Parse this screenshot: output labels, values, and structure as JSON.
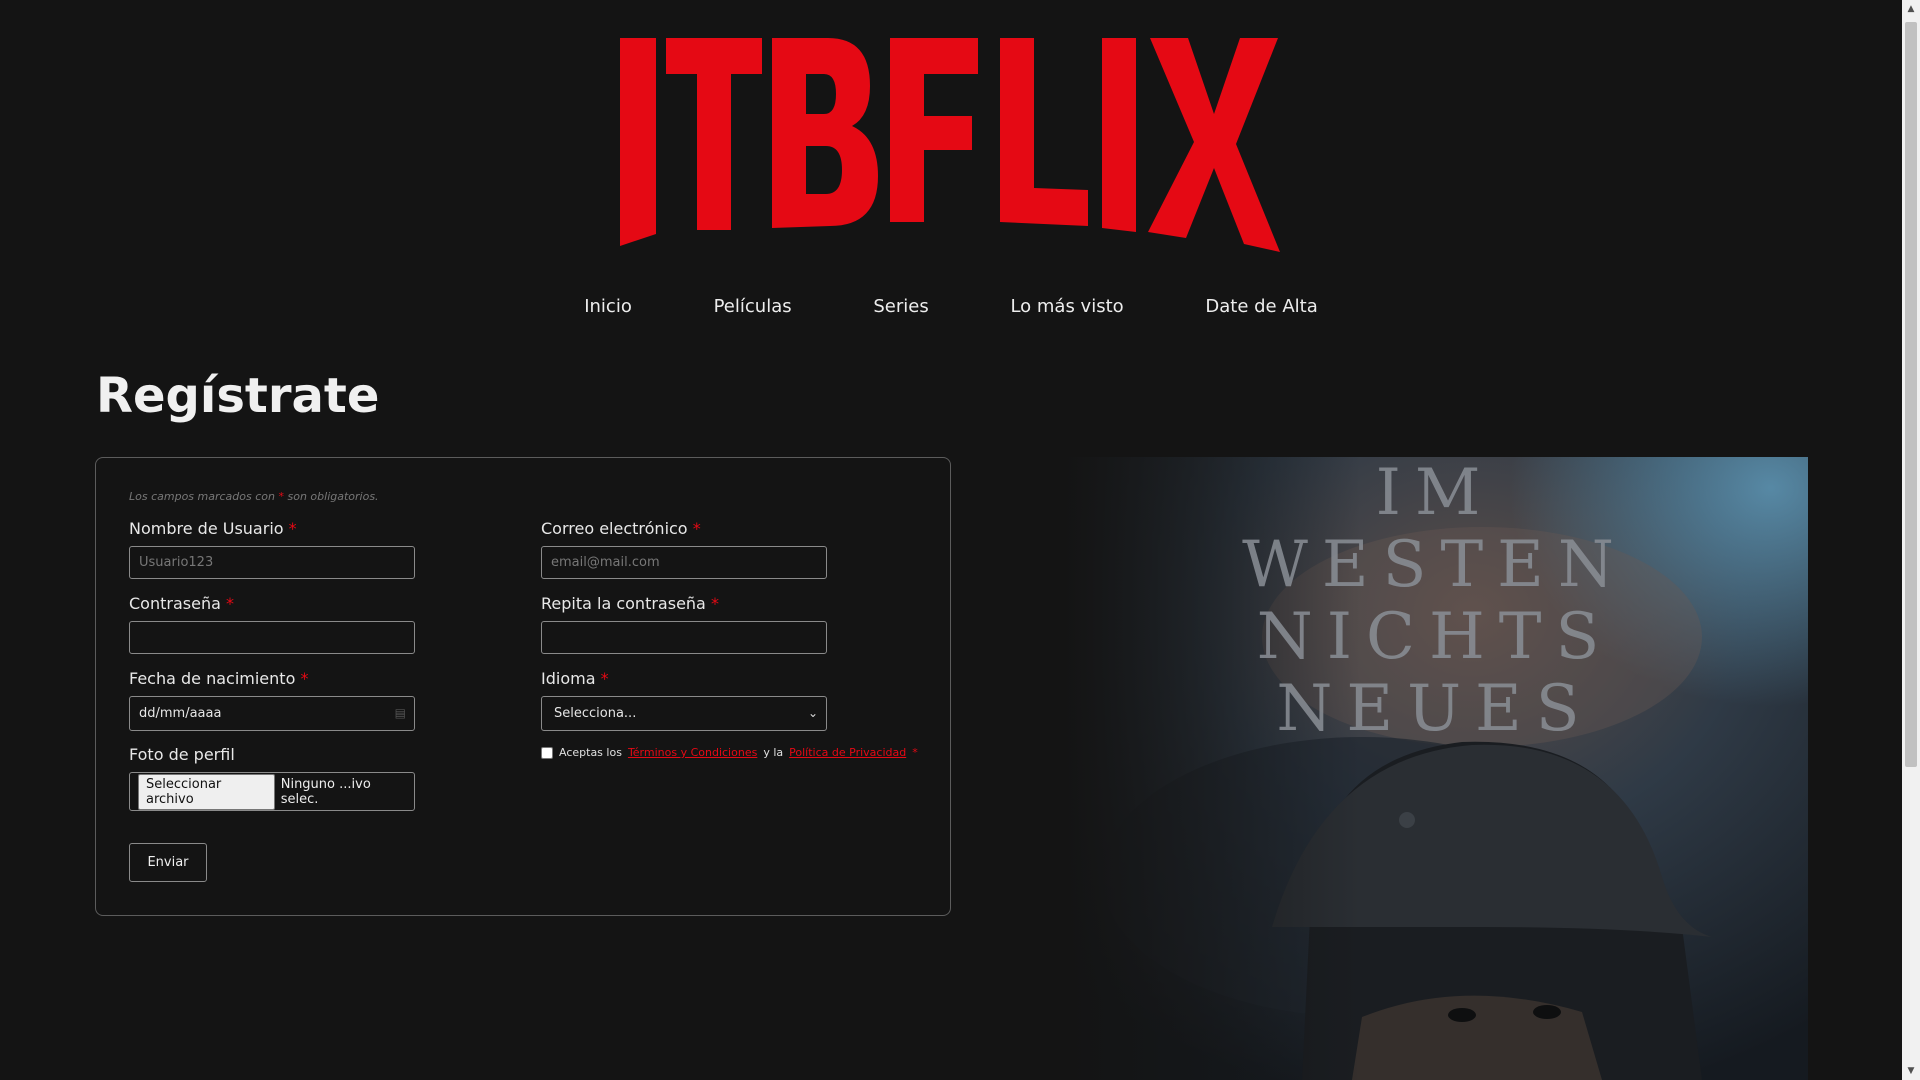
{
  "brand": {
    "logo_text": "ITBFLIX",
    "color": "#e50914"
  },
  "nav": {
    "items": [
      "Inicio",
      "Películas",
      "Series",
      "Lo más visto",
      "Date de Alta"
    ]
  },
  "page": {
    "title": "Regístrate"
  },
  "form": {
    "required_note_before": "Los campos marcados con",
    "required_note_after": "son obligatorios.",
    "required_mark": "*",
    "fields": {
      "username": {
        "label": "Nombre de Usuario",
        "placeholder": "Usuario123"
      },
      "email": {
        "label": "Correo electrónico",
        "placeholder": "email@mail.com"
      },
      "password": {
        "label": "Contraseña",
        "value": ""
      },
      "password_repeat": {
        "label": "Repita la contraseña",
        "value": ""
      },
      "birthdate": {
        "label": "Fecha de nacimiento",
        "value": "dd/mm/aaaa"
      },
      "language": {
        "label": "Idioma",
        "selected": "Selecciona..."
      },
      "photo": {
        "label": "Foto de perfil",
        "button": "Seleccionar archivo",
        "status": "Ninguno ...ivo selec."
      }
    },
    "terms": {
      "text_1": "Aceptas los",
      "link_1": "Términos y Condiciones",
      "text_2": "y la",
      "link_2": "Política de Privacidad",
      "checked": false
    },
    "submit_label": "Enviar"
  },
  "poster": {
    "lines": [
      "IM",
      "WESTEN",
      "NICHTS",
      "NEUES"
    ]
  }
}
